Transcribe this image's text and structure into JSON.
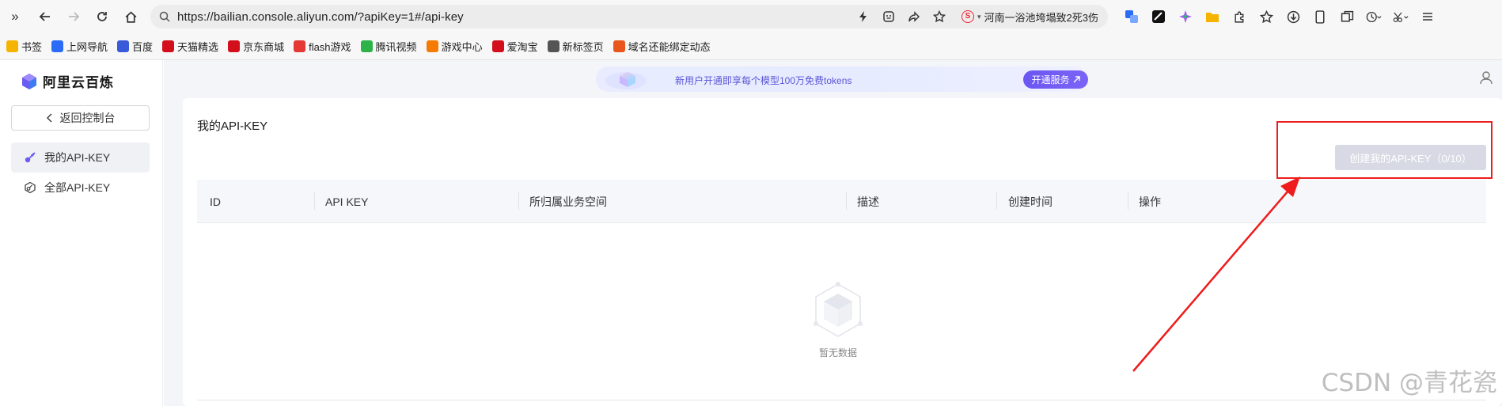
{
  "browser": {
    "url": "https://bailian.console.aliyun.com/?apiKey=1#/api-key",
    "news_ticker": "河南一浴池垮塌致2死3伤"
  },
  "bookmarks": [
    {
      "label": "书签",
      "icon": "star-icon",
      "color": "#f5b400"
    },
    {
      "label": "上网导航",
      "icon": "nav-icon",
      "color": "#2b6cf6"
    },
    {
      "label": "百度",
      "icon": "baidu-icon",
      "color": "#3a5bd9"
    },
    {
      "label": "天猫精选",
      "icon": "tmall-icon",
      "color": "#d40f1c"
    },
    {
      "label": "京东商城",
      "icon": "jd-icon",
      "color": "#d40f1c"
    },
    {
      "label": "flash游戏",
      "icon": "flash-icon",
      "color": "#e53935"
    },
    {
      "label": "腾讯视频",
      "icon": "tencent-video-icon",
      "color": "#2bb34a"
    },
    {
      "label": "游戏中心",
      "icon": "game-icon",
      "color": "#f57c00"
    },
    {
      "label": "爱淘宝",
      "icon": "taobao-icon",
      "color": "#d40f1c"
    },
    {
      "label": "新标签页",
      "icon": "new-tab-icon",
      "color": "#555555"
    },
    {
      "label": "域名还能绑定动态",
      "icon": "domain-icon",
      "color": "#e8561c"
    }
  ],
  "sidebar": {
    "brand": "阿里云百炼",
    "back_label": "返回控制台",
    "items": [
      {
        "label": "我的API-KEY",
        "active": true
      },
      {
        "label": "全部API-KEY",
        "active": false
      }
    ]
  },
  "banner": {
    "text": "新用户开通即享每个模型100万免费tokens",
    "button": "开通服务"
  },
  "page": {
    "title": "我的API-KEY",
    "create_button": "创建我的API-KEY（0/10）",
    "columns": [
      "ID",
      "API KEY",
      "所归属业务空间",
      "描述",
      "创建时间",
      "操作"
    ],
    "empty_text": "暂无数据"
  },
  "watermark": "CSDN @青花瓷",
  "colors": {
    "accent": "#6a57f2",
    "annotation": "#ee1c1c"
  }
}
